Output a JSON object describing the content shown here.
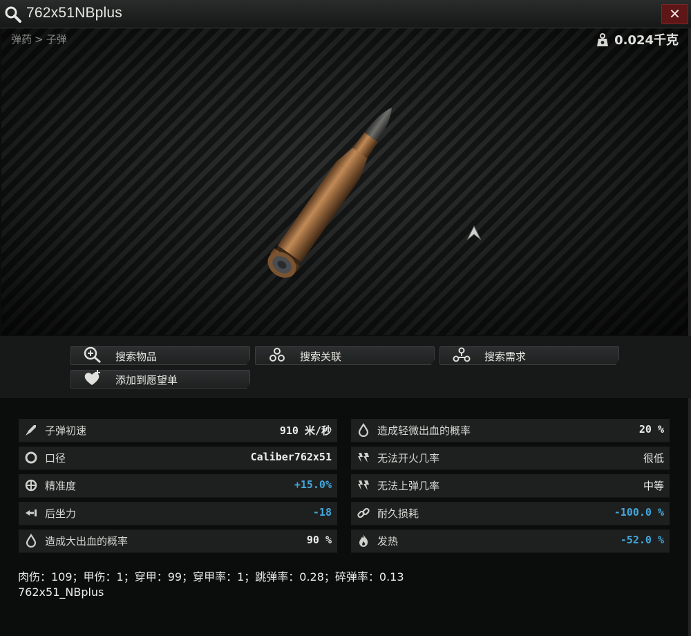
{
  "window": {
    "title": "762x51NBplus",
    "close_label": "✕"
  },
  "breadcrumb": [
    "弹药",
    ">",
    "子弹"
  ],
  "weight": "0.024千克",
  "actions": {
    "search_item": "搜索物品",
    "search_related": "搜索关联",
    "search_needs": "搜索需求",
    "add_wishlist": "添加到愿望单"
  },
  "stats_left": [
    {
      "icon": "rocket-icon",
      "name": "子弹初速",
      "value": "910 米/秒",
      "color": "#ececea"
    },
    {
      "icon": "caliber-ring-icon",
      "name": "口径",
      "value": "Caliber762x51",
      "color": "#ececea"
    },
    {
      "icon": "crosshair-icon",
      "name": "精准度",
      "value": "+15.0%",
      "color": "#43a7db"
    },
    {
      "icon": "recoil-icon",
      "name": "后坐力",
      "value": "-18",
      "color": "#43a7db"
    },
    {
      "icon": "blood-drop-icon",
      "name": "造成大出血的概率",
      "value": "90 %",
      "color": "#ececea"
    }
  ],
  "stats_right": [
    {
      "icon": "blood-drop-icon",
      "name": "造成轻微出血的概率",
      "value": "20 %",
      "color": "#ececea"
    },
    {
      "icon": "misfire-icon",
      "name": "无法开火几率",
      "value": "很低",
      "color": "#ececea"
    },
    {
      "icon": "misfeed-icon",
      "name": "无法上弹几率",
      "value": "中等",
      "color": "#ececea"
    },
    {
      "icon": "chain-link-icon",
      "name": "耐久损耗",
      "value": "-100.0 %",
      "color": "#43a7db"
    },
    {
      "icon": "flame-icon",
      "name": "发热",
      "value": "-52.0 %",
      "color": "#43a7db"
    }
  ],
  "footer": {
    "line1": "肉伤：109；甲伤：1；穿甲：99；穿甲率：1；跳弹率：0.28；碎弹率：0.13",
    "line2": "762x51_NBplus"
  }
}
